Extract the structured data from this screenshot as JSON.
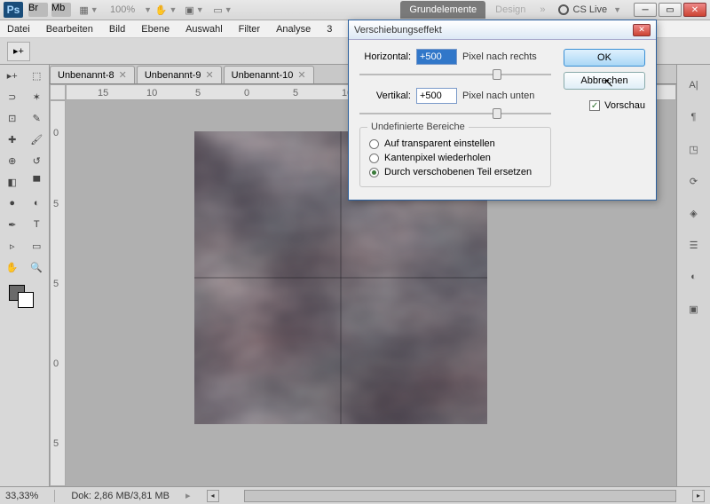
{
  "header": {
    "zoom": "100%",
    "tab_workspace": "Grundelemente",
    "tab_design": "Design",
    "cslive": "CS Live"
  },
  "menu": {
    "datei": "Datei",
    "bearbeiten": "Bearbeiten",
    "bild": "Bild",
    "ebene": "Ebene",
    "auswahl": "Auswahl",
    "filter": "Filter",
    "analyse": "Analyse",
    "drei": "3"
  },
  "docs": [
    {
      "title": "Unbenannt-8"
    },
    {
      "title": "Unbenannt-9"
    },
    {
      "title": "Unbenannt-10"
    }
  ],
  "ruler_h": [
    "15",
    "10",
    "5",
    "0",
    "5",
    "10"
  ],
  "ruler_v": [
    "0",
    "5",
    "5",
    "0",
    "5"
  ],
  "status": {
    "zoom": "33,33%",
    "docsize": "Dok: 2,86 MB/3,81 MB"
  },
  "dialog": {
    "title": "Verschiebungseffekt",
    "horizontal_label": "Horizontal:",
    "horizontal_value": "+500",
    "horizontal_suffix": "Pixel nach rechts",
    "vertical_label": "Vertikal:",
    "vertical_value": "+500",
    "vertical_suffix": "Pixel nach unten",
    "group_title": "Undefinierte Bereiche",
    "radio1": "Auf transparent einstellen",
    "radio2": "Kantenpixel wiederholen",
    "radio3": "Durch verschobenen Teil ersetzen",
    "ok": "OK",
    "cancel": "Abbrechen",
    "preview": "Vorschau"
  }
}
